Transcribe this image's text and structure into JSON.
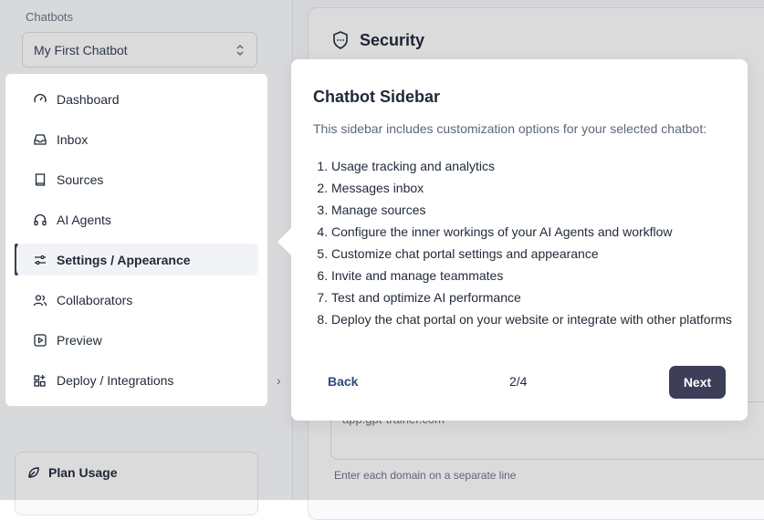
{
  "sidebar": {
    "section_label": "Chatbots",
    "selected_chatbot": "My First Chatbot",
    "menu": [
      {
        "label": "Dashboard",
        "icon": "gauge-icon"
      },
      {
        "label": "Inbox",
        "icon": "inbox-icon"
      },
      {
        "label": "Sources",
        "icon": "book-icon"
      },
      {
        "label": "AI Agents",
        "icon": "headphones-icon"
      },
      {
        "label": "Settings / Appearance",
        "icon": "sliders-icon",
        "active": true
      },
      {
        "label": "Collaborators",
        "icon": "users-icon"
      },
      {
        "label": "Preview",
        "icon": "play-square-icon"
      },
      {
        "label": "Deploy / Integrations",
        "icon": "grid-plus-icon"
      }
    ],
    "plan_card": {
      "title": "Plan Usage"
    }
  },
  "main": {
    "section_title": "Security",
    "domain_value": "app.gpt-trainer.com",
    "domain_hint": "Enter each domain on a separate line"
  },
  "tour": {
    "title": "Chatbot Sidebar",
    "description": "This sidebar includes customization options for your selected chatbot:",
    "items": [
      "Usage tracking and analytics",
      "Messages inbox",
      "Manage sources",
      "Configure the inner workings of your AI Agents and workflow",
      "Customize chat portal settings and appearance",
      "Invite and manage teammates",
      "Test and optimize AI performance",
      "Deploy the chat portal on your website or integrate with other platforms"
    ],
    "back_label": "Back",
    "step": "2/4",
    "next_label": "Next"
  },
  "colors": {
    "accent": "#3c3f57",
    "back_link": "#2f4a7d"
  }
}
